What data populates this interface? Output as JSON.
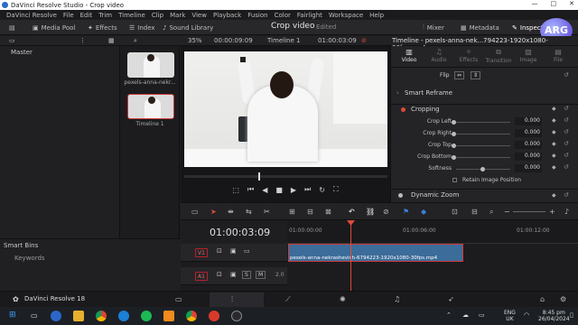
{
  "window": {
    "title": "DaVinci Resolve Studio - Crop video",
    "controls": [
      "—",
      "□",
      "✕"
    ]
  },
  "menu": [
    "DaVinci Resolve",
    "File",
    "Edit",
    "Trim",
    "Timeline",
    "Clip",
    "Mark",
    "View",
    "Playback",
    "Fusion",
    "Color",
    "Fairlight",
    "Workspace",
    "Help"
  ],
  "toolbar": {
    "media_pool": "Media Pool",
    "effects": "Effects",
    "index": "Index",
    "sound_library": "Sound Library",
    "project_title": "Crop video",
    "edited": "Edited",
    "mixer": "Mixer",
    "metadata": "Metadata",
    "inspector": "Inspector"
  },
  "subbar": {
    "zoom": "35%",
    "source_tc": "00:00:09:09",
    "timeline_name": "Timeline 1",
    "record_tc": "01:00:03:09",
    "clip_name": "Timeline - pexels-anna-nek...794223-1920x1080-30fps.mp4"
  },
  "media_pool": {
    "master_label": "Master",
    "clips": [
      {
        "label": "pexels-anna-nekr..."
      },
      {
        "label": "Timeline 1"
      }
    ],
    "smart_bins_label": "Smart Bins",
    "keywords_label": "Keywords"
  },
  "inspector": {
    "tabs": [
      {
        "label": "Video",
        "icon": "film-icon"
      },
      {
        "label": "Audio",
        "icon": "music-icon"
      },
      {
        "label": "Effects",
        "icon": "effects-icon"
      },
      {
        "label": "Transition",
        "icon": "transition-icon"
      },
      {
        "label": "Image",
        "icon": "image-icon"
      },
      {
        "label": "File",
        "icon": "file-icon"
      }
    ],
    "flip_label": "Flip",
    "smart_reframe_label": "Smart Reframe",
    "cropping_label": "Cropping",
    "params": [
      {
        "label": "Crop Left",
        "value": "0.000"
      },
      {
        "label": "Crop Right",
        "value": "0.000"
      },
      {
        "label": "Crop Top",
        "value": "0.000"
      },
      {
        "label": "Crop Bottom",
        "value": "0.000"
      },
      {
        "label": "Softness",
        "value": "0.000"
      }
    ],
    "retain_label": "Retain Image Position",
    "dynamic_zoom_label": "Dynamic Zoom"
  },
  "timeline": {
    "timecode": "01:00:03:09",
    "ruler_marks": [
      "01:00:00:00",
      "01:00:06:00",
      "01:00:12:00"
    ],
    "v1": "V1",
    "a1": "A1",
    "a1_level": "2.0",
    "clip_label": "pexels-anna-nekrashevich-6794223-1920x1080-30fps.mp4",
    "mute_label": "S",
    "solo_label": "M"
  },
  "pagebar": {
    "app_name": "DaVinci Resolve 18"
  },
  "taskbar": {
    "lang": "ENG",
    "region": "UK",
    "time": "8:45 pm",
    "date": "26/04/2024"
  },
  "logo": "ARG",
  "colors": {
    "accent_red": "#e04a3a",
    "clip_blue": "#3c6c9a",
    "v1_tag": "#b8202a",
    "a1_tag": "#b8202a"
  }
}
